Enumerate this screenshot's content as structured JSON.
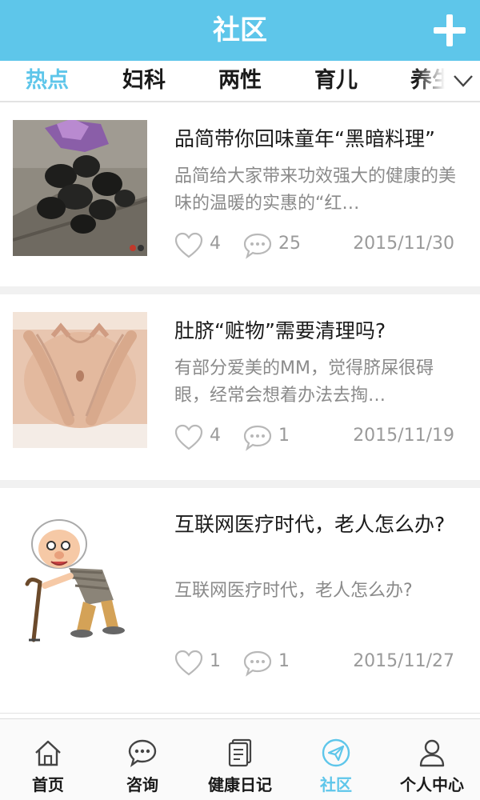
{
  "header": {
    "title": "社区",
    "add_icon": "plus-icon"
  },
  "tabs": [
    {
      "label": "热点",
      "active": true
    },
    {
      "label": "妇科"
    },
    {
      "label": "两性"
    },
    {
      "label": "育儿"
    },
    {
      "label": "养生"
    }
  ],
  "articles": [
    {
      "title": "品简带你回味童年“黑暗料理”",
      "desc": "品简给大家带来功效强大的健康的美味的温暖的实惠的“红…",
      "likes": "4",
      "comments": "25",
      "date": "2015/11/30",
      "image": "dark-food-photo"
    },
    {
      "title": "肚脐“赃物”需要清理吗?",
      "desc": "有部分爱美的MM，觉得脐屎很碍眼，经常会想着办法去掏…",
      "likes": "4",
      "comments": "1",
      "date": "2015/11/19",
      "image": "belly-hands-photo"
    },
    {
      "title": "互联网医疗时代，老人怎么办?",
      "desc": "互联网医疗时代，老人怎么办?",
      "likes": "1",
      "comments": "1",
      "date": "2015/11/27",
      "image": "old-man-cartoon"
    }
  ],
  "bottom_nav": [
    {
      "label": "首页",
      "icon": "home-icon"
    },
    {
      "label": "咨询",
      "icon": "chat-icon"
    },
    {
      "label": "健康日记",
      "icon": "diary-icon"
    },
    {
      "label": "社区",
      "icon": "send-icon",
      "active": true
    },
    {
      "label": "个人中心",
      "icon": "user-icon"
    }
  ],
  "colors": {
    "accent": "#5ec6ea",
    "text": "#1a1a1a",
    "muted": "#8a8a8a",
    "divider": "#f1f1f1"
  }
}
